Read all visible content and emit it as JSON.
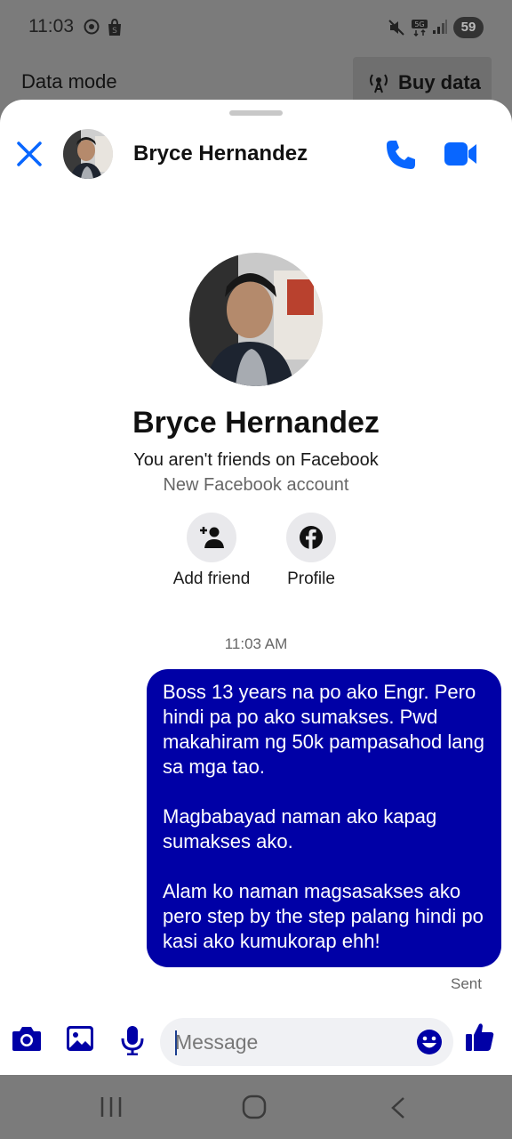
{
  "status_bar": {
    "time": "11:03",
    "battery": "59",
    "icons": [
      "chrome-icon",
      "shopee-icon",
      "mute-icon",
      "5g-icon",
      "signal-icon"
    ]
  },
  "backdrop": {
    "data_mode_label": "Data mode",
    "buy_data_label": "Buy data"
  },
  "header": {
    "contact_name": "Bryce Hernandez"
  },
  "profile": {
    "name": "Bryce Hernandez",
    "relationship": "You aren't friends on Facebook",
    "account_note": "New Facebook account",
    "actions": [
      {
        "label": "Add friend",
        "icon": "add-friend-icon"
      },
      {
        "label": "Profile",
        "icon": "facebook-icon"
      }
    ]
  },
  "conversation": {
    "timestamp": "11:03 AM",
    "messages": [
      {
        "direction": "outgoing",
        "paragraphs": [
          "Boss 13 years na po ako Engr. Pero hindi pa po ako sumakses. Pwd makahiram ng 50k pampasahod lang sa mga tao.",
          "Magbabayad naman ako kapag sumakses ako.",
          "Alam ko naman magsasakses ako pero step by the step palang hindi po kasi ako kumukorap ehh!"
        ],
        "status": "Sent"
      }
    ]
  },
  "composer": {
    "placeholder": "Message"
  },
  "colors": {
    "accent": "#0866ff",
    "bubble": "#0000a6"
  }
}
